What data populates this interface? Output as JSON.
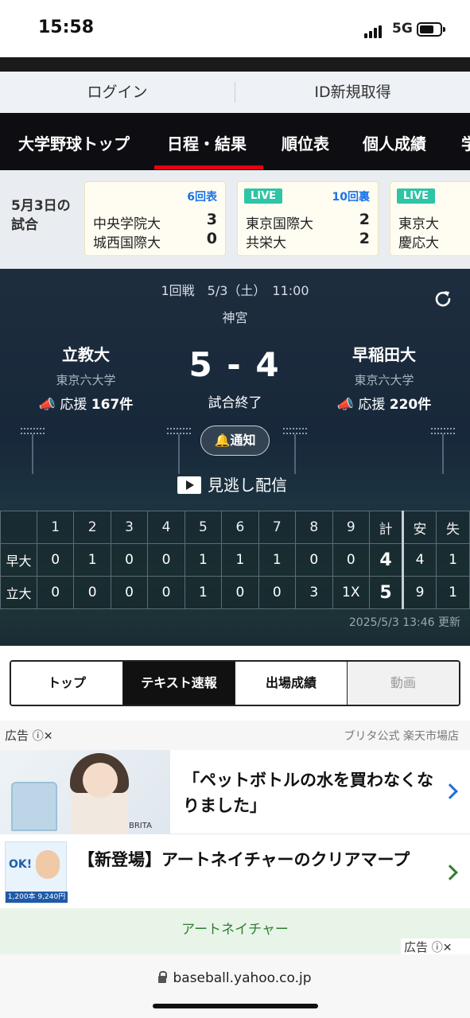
{
  "status": {
    "time": "15:58",
    "network": "5G"
  },
  "login": {
    "login_label": "ログイン",
    "register_label": "ID新規取得"
  },
  "nav": {
    "items": [
      "大学野球トップ",
      "日程・結果",
      "順位表",
      "個人成績",
      "学"
    ],
    "active": "日程・結果",
    "accent": "#e60012"
  },
  "strip": {
    "date_label": "5月3日の試合",
    "cards": [
      {
        "status": "",
        "inning": "6回表",
        "team1": "中央学院大",
        "score1": "3",
        "team2": "城西国際大",
        "score2": "0"
      },
      {
        "status": "LIVE",
        "inning": "10回裏",
        "team1": "東京国際大",
        "score1": "2",
        "team2": "共栄大",
        "score2": "2"
      },
      {
        "status": "LIVE",
        "inning": "",
        "team1": "東京大",
        "score1": "",
        "team2": "慶応大",
        "score2": ""
      }
    ]
  },
  "game": {
    "meta": "1回戦　5/3（土）　11:00",
    "venue": "神宮",
    "home": {
      "name": "立教大",
      "league": "東京六大学",
      "cheer_label": "応援",
      "cheer_count": "167件"
    },
    "away": {
      "name": "早稲田大",
      "league": "東京六大学",
      "cheer_label": "応援",
      "cheer_count": "220件"
    },
    "score": "5 - 4",
    "result": "試合終了",
    "notify_label": "通知",
    "replay_label": "見逃し配信"
  },
  "scoreboard": {
    "headers": [
      "",
      "1",
      "2",
      "3",
      "4",
      "5",
      "6",
      "7",
      "8",
      "9",
      "計",
      "安",
      "失"
    ],
    "rows": [
      {
        "team": "早大",
        "innings": [
          "0",
          "1",
          "0",
          "0",
          "1",
          "1",
          "1",
          "0",
          "0"
        ],
        "total": "4",
        "hits": "4",
        "errors": "1"
      },
      {
        "team": "立大",
        "innings": [
          "0",
          "0",
          "0",
          "0",
          "1",
          "0",
          "0",
          "3",
          "1X"
        ],
        "total": "5",
        "hits": "9",
        "errors": "1"
      }
    ],
    "updated": "2025/5/3 13:46 更新"
  },
  "tabs": {
    "items": [
      "トップ",
      "テキスト速報",
      "出場成績",
      "動画"
    ],
    "active": "テキスト速報"
  },
  "ads": {
    "label": "広告",
    "source": "ブリタ公式 楽天市場店",
    "ad1_text": "「ペットボトルの水を買わなくなりました」",
    "ad1_brand": "BRITA",
    "ad2_text": "【新登場】アートネイチャーのクリアマープ",
    "ad2_img_text": "OK!",
    "ad2_img_bar": "1,200本 9,240円",
    "footer": "アートネイチャー",
    "label2": "広告"
  },
  "browser": {
    "url": "baseball.yahoo.co.jp"
  }
}
